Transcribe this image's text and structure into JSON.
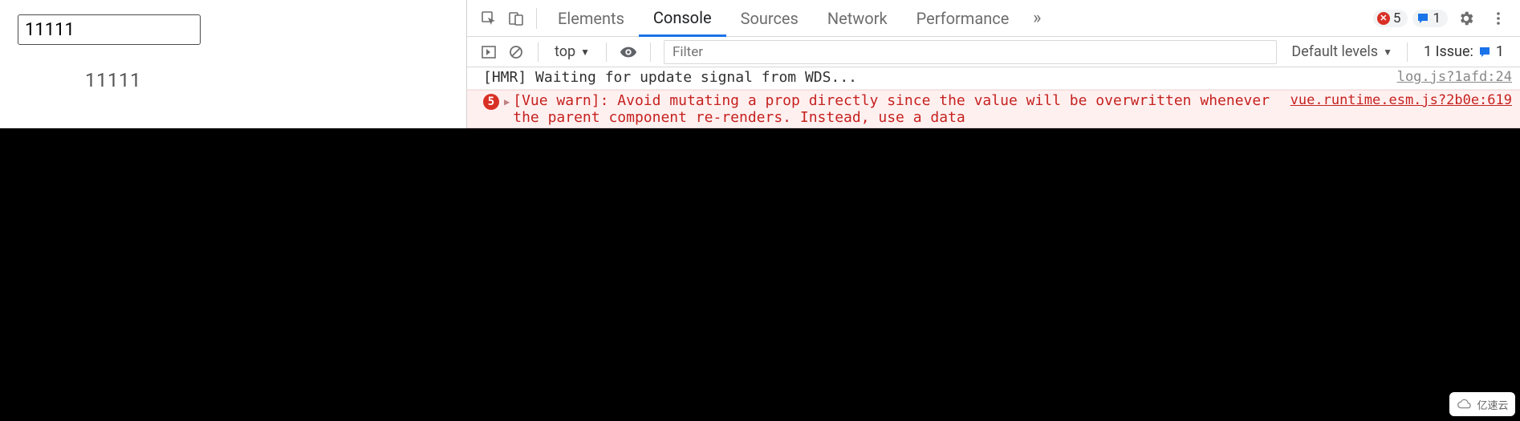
{
  "page": {
    "input_value": "11111",
    "output_text": "11111"
  },
  "devtools": {
    "tabs": [
      "Elements",
      "Console",
      "Sources",
      "Network",
      "Performance"
    ],
    "active_tab": "Console",
    "error_badge_count": "5",
    "info_badge_count": "1",
    "toolbar": {
      "context": "top",
      "filter_placeholder": "Filter",
      "levels_label": "Default levels",
      "issues_label": "1 Issue:",
      "issues_count": "1"
    },
    "log": {
      "hmr_msg": "[HMR] Waiting for update signal from WDS...",
      "hmr_src": "log.js?1afd:24",
      "err_count": "5",
      "err_msg": "[Vue warn]: Avoid mutating a prop directly since the value will be overwritten whenever the parent component re-renders. Instead, use a data",
      "err_src": "vue.runtime.esm.js?2b0e:619"
    }
  },
  "watermark": "亿速云"
}
